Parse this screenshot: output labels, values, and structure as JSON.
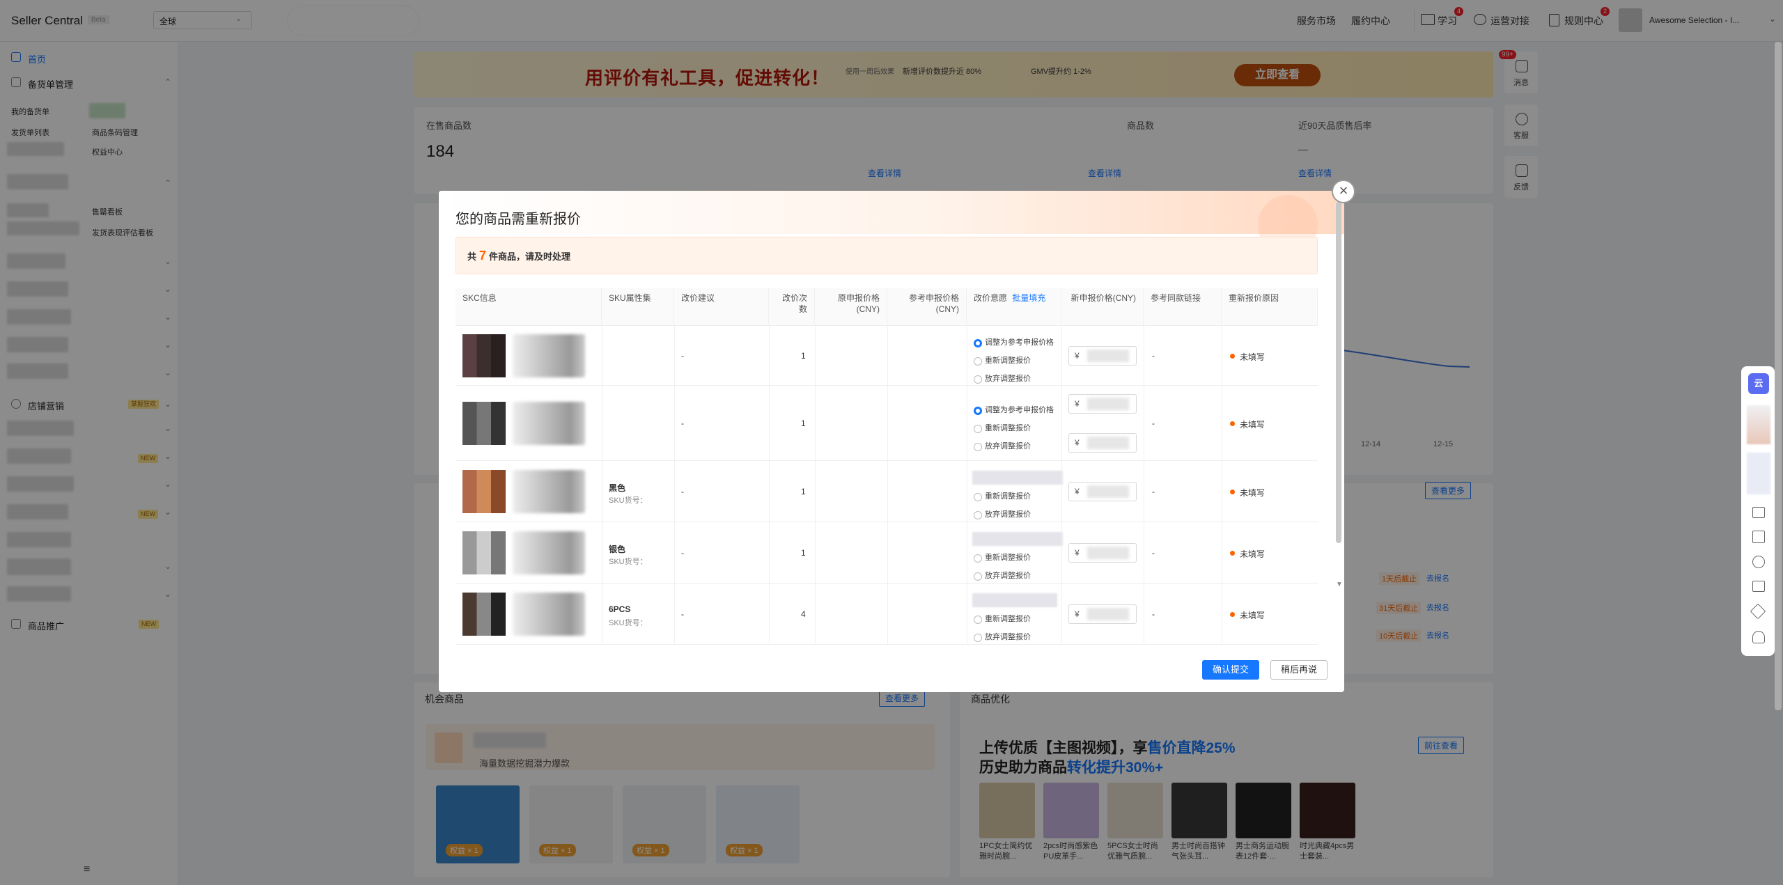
{
  "header": {
    "brand": "Seller Central",
    "beta": "Beta",
    "region": "全球",
    "nav": [
      {
        "label": "服务市场"
      },
      {
        "label": "履约中心"
      },
      {
        "label": "学习",
        "badge": "4"
      },
      {
        "label": "运营对接"
      },
      {
        "label": "规则中心",
        "badge": "2"
      }
    ],
    "account": "Awesome Selection - I..."
  },
  "sidebar": {
    "home": "首页",
    "stock_mgmt": "备货单管理",
    "sub_items": [
      "我的备货单",
      "发货单列表",
      "商品条码管理",
      "权益中心",
      "售罄看板",
      "发货表现评估看板"
    ],
    "store_marketing": "店铺营销",
    "store_marketing_tag": "掌握狂欢",
    "new_tag": "NEW",
    "product_promo": "商品推广"
  },
  "main": {
    "stat1_label": "在售商品数",
    "stat1_value": "184",
    "stat2_label": "商品数",
    "stat3_label": "近90天品质售后率",
    "stat3_value": "—",
    "view_detail": "查看详情",
    "opp_title": "机会商品",
    "opp_sub": "海量数据挖掘潜力爆款",
    "view_more": "查看更多",
    "optimize_title": "商品优化",
    "goto_view": "前往查看",
    "upload_line1": "上传优质【主图视频】，享",
    "upload_line1_hl": "售价直降25%",
    "upload_line2": "历史助力商品",
    "upload_line2_hl": "转化提升30%+",
    "thumbs": [
      "1PC女士简约优雅时尚腕...",
      "2pcs时尚感紫色PU皮革手...",
      "5PCS女士时尚优雅气质腕...",
      "男士时尚百搭钟气张头耳...",
      "男士商务运动腕表12件套·...",
      "时光典藏4pcs男士套装..."
    ],
    "chart_dates": [
      "12-14",
      "12-15"
    ],
    "deadlines": [
      "1天后截止",
      "31天后截止",
      "10天后截止"
    ],
    "signup": "去报名",
    "rights_tag": "权益 × 1"
  },
  "banner": {
    "title": "用评价有礼工具，促进转化！",
    "line1": "使用一周后效果",
    "stat1": "新增评价数提升近 80%",
    "stat2": "GMV提升约 1-2%",
    "btn": "立即查看"
  },
  "rightbar": {
    "msg_badge": "99+",
    "items": [
      "消息",
      "客服",
      "反馈"
    ]
  },
  "modal": {
    "title": "您的商品需重新报价",
    "notice_prefix": "共",
    "notice_count": "7",
    "notice_suffix": "件商品，请及时处理",
    "batch_fill": "批量填充",
    "columns": [
      "SKC信息",
      "SKU属性集",
      "改价建议",
      "改价次数",
      "原申报价格(CNY)",
      "参考申报价格(CNY)",
      "改价意愿",
      "新申报价格(CNY)",
      "参考同款链接",
      "重新报价原因"
    ],
    "options": {
      "adjust_ref": "调整为参考申报价格",
      "readjust": "重新调整报价",
      "abandon": "放弃调整报价"
    },
    "currency": "¥",
    "rows": [
      {
        "sku_attr": "",
        "sku_code": "",
        "suggest": "-",
        "times": "1",
        "ref_link": "-",
        "status": "未填写"
      },
      {
        "sku_attr": "",
        "sku_code": "",
        "suggest": "-",
        "times": "1",
        "ref_link": "-",
        "status": "未填写"
      },
      {
        "sku_attr": "黑色",
        "sku_code": "SKU货号：",
        "suggest": "-",
        "times": "1",
        "ref_link": "-",
        "status": "未填写"
      },
      {
        "sku_attr": "银色",
        "sku_code": "SKU货号：",
        "suggest": "-",
        "times": "1",
        "ref_link": "-",
        "status": "未填写"
      },
      {
        "sku_attr": "6PCS",
        "sku_code": "SKU货号：",
        "suggest": "-",
        "times": "4",
        "ref_link": "-",
        "status": "未填写"
      }
    ],
    "confirm": "确认提交",
    "later": "稍后再说",
    "close": "×"
  }
}
